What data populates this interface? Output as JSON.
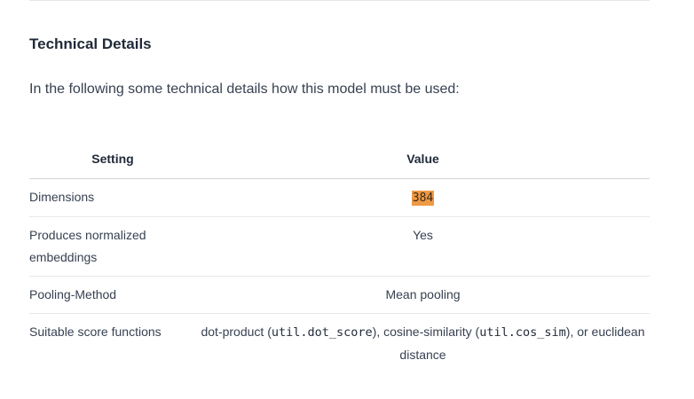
{
  "section": {
    "title": "Technical Details",
    "intro": "In the following some technical details how this model must be used:"
  },
  "table": {
    "headers": {
      "setting": "Setting",
      "value": "Value"
    },
    "rows": [
      {
        "setting": "Dimensions",
        "value": "384"
      },
      {
        "setting": "Produces normalized embeddings",
        "value": "Yes"
      },
      {
        "setting": "Pooling-Method",
        "value": "Mean pooling"
      },
      {
        "setting": "Suitable score functions",
        "value_parts": {
          "p1": "dot-product (",
          "code1": "util.dot_score",
          "p2": "), cosine-similarity (",
          "code2": "util.cos_sim",
          "p3": "), or euclidean distance"
        }
      }
    ]
  },
  "colors": {
    "highlight": "#ee9a44",
    "divider": "#e5e7eb",
    "text": "#374151"
  }
}
